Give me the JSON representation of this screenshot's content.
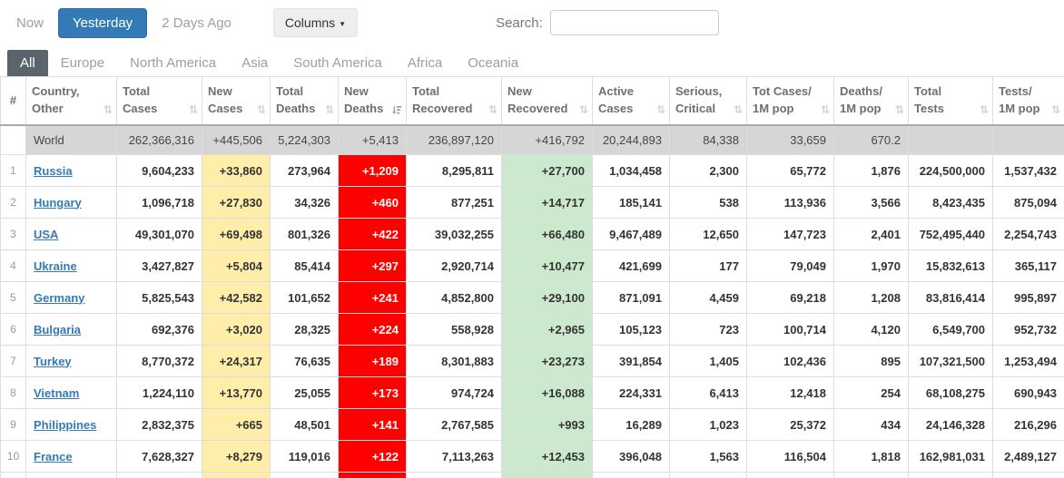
{
  "toolbar": {
    "now_label": "Now",
    "yesterday_label": "Yesterday",
    "two_days_label": "2 Days Ago",
    "columns_label": "Columns",
    "columns_caret_icon": "▼",
    "search_label": "Search:",
    "search_value": "",
    "search_placeholder": ""
  },
  "tabs": [
    {
      "label": "All",
      "active": true
    },
    {
      "label": "Europe",
      "active": false
    },
    {
      "label": "North America",
      "active": false
    },
    {
      "label": "Asia",
      "active": false
    },
    {
      "label": "South America",
      "active": false
    },
    {
      "label": "Africa",
      "active": false
    },
    {
      "label": "Oceania",
      "active": false
    }
  ],
  "table": {
    "sort_icon_glyph": "⇅",
    "headers": [
      {
        "key": "rank",
        "line1": "#",
        "line2": "",
        "sortable": false,
        "sort_active": false
      },
      {
        "key": "country",
        "line1": "Country,",
        "line2": "Other",
        "sortable": true,
        "sort_active": false
      },
      {
        "key": "total_cases",
        "line1": "Total",
        "line2": "Cases",
        "sortable": true,
        "sort_active": false
      },
      {
        "key": "new_cases",
        "line1": "New",
        "line2": "Cases",
        "sortable": true,
        "sort_active": false
      },
      {
        "key": "total_deaths",
        "line1": "Total",
        "line2": "Deaths",
        "sortable": true,
        "sort_active": false
      },
      {
        "key": "new_deaths",
        "line1": "New",
        "line2": "Deaths",
        "sortable": true,
        "sort_active": true
      },
      {
        "key": "total_recovered",
        "line1": "Total",
        "line2": "Recovered",
        "sortable": true,
        "sort_active": false
      },
      {
        "key": "new_recovered",
        "line1": "New",
        "line2": "Recovered",
        "sortable": true,
        "sort_active": false
      },
      {
        "key": "active_cases",
        "line1": "Active",
        "line2": "Cases",
        "sortable": true,
        "sort_active": false
      },
      {
        "key": "serious_critical",
        "line1": "Serious,",
        "line2": "Critical",
        "sortable": true,
        "sort_active": false
      },
      {
        "key": "cases_per_1m",
        "line1": "Tot Cases/",
        "line2": "1M pop",
        "sortable": true,
        "sort_active": false
      },
      {
        "key": "deaths_per_1m",
        "line1": "Deaths/",
        "line2": "1M pop",
        "sortable": true,
        "sort_active": false
      },
      {
        "key": "total_tests",
        "line1": "Total",
        "line2": "Tests",
        "sortable": true,
        "sort_active": false
      },
      {
        "key": "tests_per_1m",
        "line1": "Tests/",
        "line2": "1M pop",
        "sortable": true,
        "sort_active": false
      }
    ],
    "world_row": {
      "rank": "",
      "country": "World",
      "total_cases": "262,366,316",
      "new_cases": "+445,506",
      "total_deaths": "5,224,303",
      "new_deaths": "+5,413",
      "total_recovered": "236,897,120",
      "new_recovered": "+416,792",
      "active_cases": "20,244,893",
      "serious_critical": "84,338",
      "cases_per_1m": "33,659",
      "deaths_per_1m": "670.2",
      "total_tests": "",
      "tests_per_1m": ""
    },
    "rows": [
      {
        "rank": "1",
        "country": "Russia",
        "total_cases": "9,604,233",
        "new_cases": "+33,860",
        "total_deaths": "273,964",
        "new_deaths": "+1,209",
        "total_recovered": "8,295,811",
        "new_recovered": "+27,700",
        "active_cases": "1,034,458",
        "serious_critical": "2,300",
        "cases_per_1m": "65,772",
        "deaths_per_1m": "1,876",
        "total_tests": "224,500,000",
        "tests_per_1m": "1,537,432"
      },
      {
        "rank": "2",
        "country": "Hungary",
        "total_cases": "1,096,718",
        "new_cases": "+27,830",
        "total_deaths": "34,326",
        "new_deaths": "+460",
        "total_recovered": "877,251",
        "new_recovered": "+14,717",
        "active_cases": "185,141",
        "serious_critical": "538",
        "cases_per_1m": "113,936",
        "deaths_per_1m": "3,566",
        "total_tests": "8,423,435",
        "tests_per_1m": "875,094"
      },
      {
        "rank": "3",
        "country": "USA",
        "total_cases": "49,301,070",
        "new_cases": "+69,498",
        "total_deaths": "801,326",
        "new_deaths": "+422",
        "total_recovered": "39,032,255",
        "new_recovered": "+66,480",
        "active_cases": "9,467,489",
        "serious_critical": "12,650",
        "cases_per_1m": "147,723",
        "deaths_per_1m": "2,401",
        "total_tests": "752,495,440",
        "tests_per_1m": "2,254,743"
      },
      {
        "rank": "4",
        "country": "Ukraine",
        "total_cases": "3,427,827",
        "new_cases": "+5,804",
        "total_deaths": "85,414",
        "new_deaths": "+297",
        "total_recovered": "2,920,714",
        "new_recovered": "+10,477",
        "active_cases": "421,699",
        "serious_critical": "177",
        "cases_per_1m": "79,049",
        "deaths_per_1m": "1,970",
        "total_tests": "15,832,613",
        "tests_per_1m": "365,117"
      },
      {
        "rank": "5",
        "country": "Germany",
        "total_cases": "5,825,543",
        "new_cases": "+42,582",
        "total_deaths": "101,652",
        "new_deaths": "+241",
        "total_recovered": "4,852,800",
        "new_recovered": "+29,100",
        "active_cases": "871,091",
        "serious_critical": "4,459",
        "cases_per_1m": "69,218",
        "deaths_per_1m": "1,208",
        "total_tests": "83,816,414",
        "tests_per_1m": "995,897"
      },
      {
        "rank": "6",
        "country": "Bulgaria",
        "total_cases": "692,376",
        "new_cases": "+3,020",
        "total_deaths": "28,325",
        "new_deaths": "+224",
        "total_recovered": "558,928",
        "new_recovered": "+2,965",
        "active_cases": "105,123",
        "serious_critical": "723",
        "cases_per_1m": "100,714",
        "deaths_per_1m": "4,120",
        "total_tests": "6,549,700",
        "tests_per_1m": "952,732"
      },
      {
        "rank": "7",
        "country": "Turkey",
        "total_cases": "8,770,372",
        "new_cases": "+24,317",
        "total_deaths": "76,635",
        "new_deaths": "+189",
        "total_recovered": "8,301,883",
        "new_recovered": "+23,273",
        "active_cases": "391,854",
        "serious_critical": "1,405",
        "cases_per_1m": "102,436",
        "deaths_per_1m": "895",
        "total_tests": "107,321,500",
        "tests_per_1m": "1,253,494"
      },
      {
        "rank": "8",
        "country": "Vietnam",
        "total_cases": "1,224,110",
        "new_cases": "+13,770",
        "total_deaths": "25,055",
        "new_deaths": "+173",
        "total_recovered": "974,724",
        "new_recovered": "+16,088",
        "active_cases": "224,331",
        "serious_critical": "6,413",
        "cases_per_1m": "12,418",
        "deaths_per_1m": "254",
        "total_tests": "68,108,275",
        "tests_per_1m": "690,943"
      },
      {
        "rank": "9",
        "country": "Philippines",
        "total_cases": "2,832,375",
        "new_cases": "+665",
        "total_deaths": "48,501",
        "new_deaths": "+141",
        "total_recovered": "2,767,585",
        "new_recovered": "+993",
        "active_cases": "16,289",
        "serious_critical": "1,023",
        "cases_per_1m": "25,372",
        "deaths_per_1m": "434",
        "total_tests": "24,146,328",
        "tests_per_1m": "216,296"
      },
      {
        "rank": "10",
        "country": "France",
        "total_cases": "7,628,327",
        "new_cases": "+8,279",
        "total_deaths": "119,016",
        "new_deaths": "+122",
        "total_recovered": "7,113,263",
        "new_recovered": "+12,453",
        "active_cases": "396,048",
        "serious_critical": "1,563",
        "cases_per_1m": "116,504",
        "deaths_per_1m": "1,818",
        "total_tests": "162,981,031",
        "tests_per_1m": "2,489,127"
      }
    ]
  },
  "colors": {
    "accent_blue": "#337AB7",
    "new_cases_bg": "#FFEEAA",
    "new_deaths_bg": "#FF0000",
    "new_recovered_bg": "#CDE9CD",
    "world_row_bg": "#D6D6D6",
    "active_tab_bg": "#5A646D",
    "link_blue": "#337AB7"
  }
}
